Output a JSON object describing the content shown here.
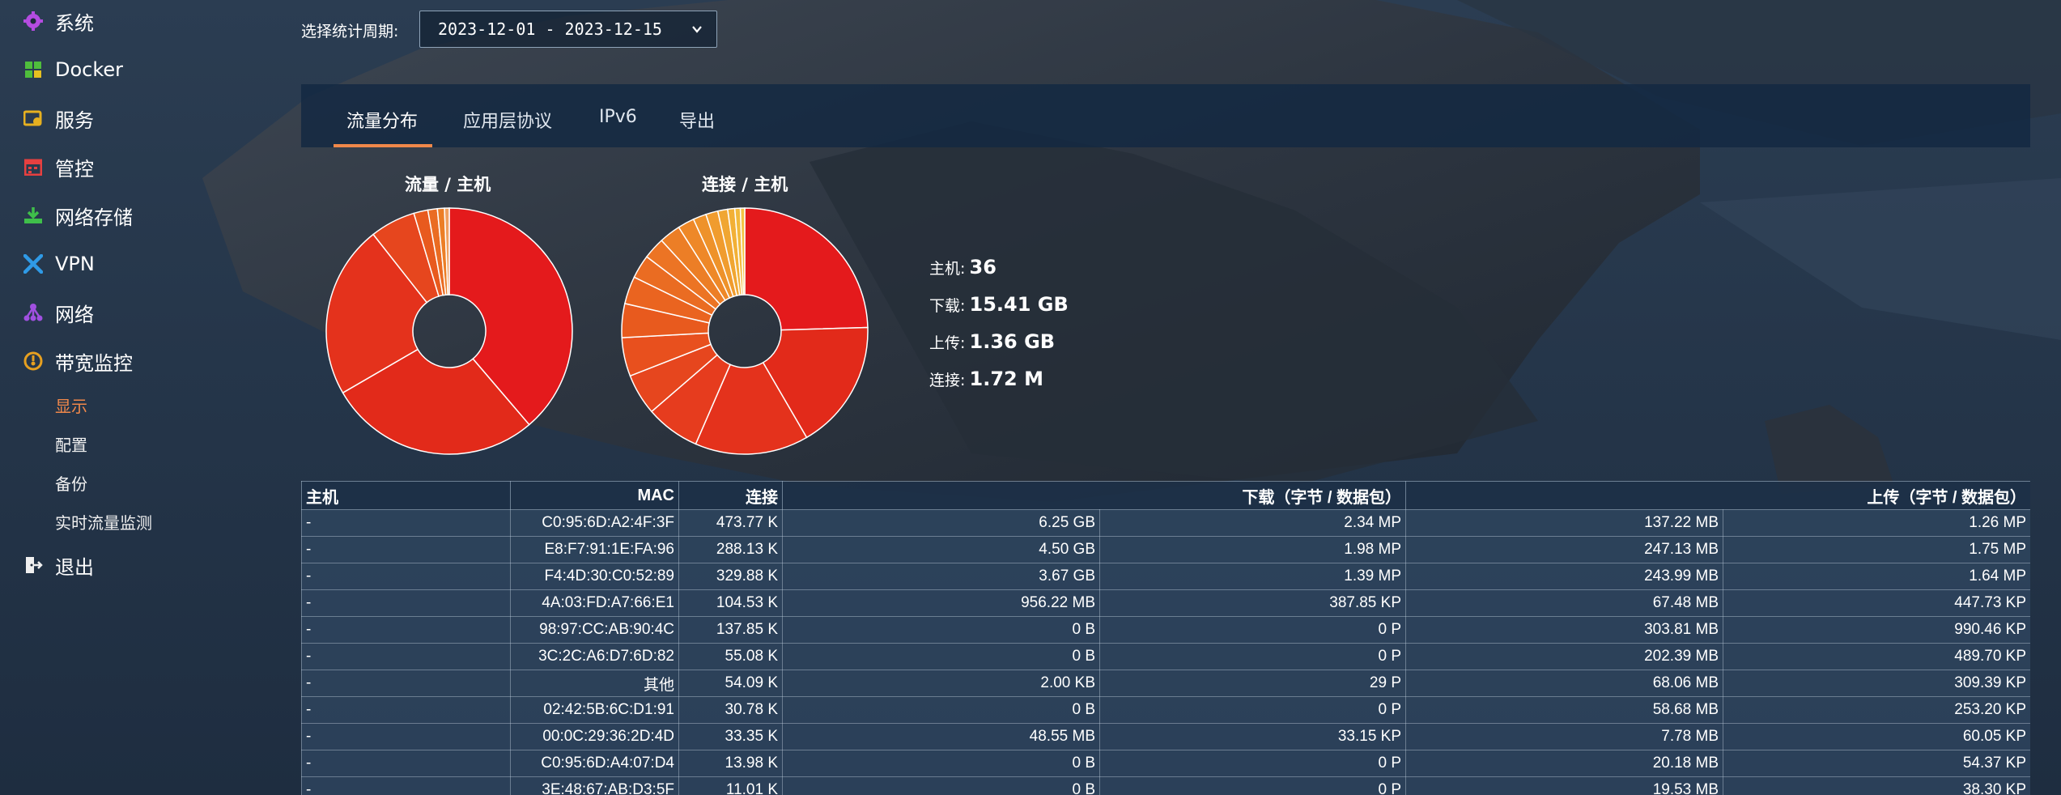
{
  "sidebar": {
    "items": [
      {
        "label": "系统",
        "icon": "gear-icon",
        "color": "#b44ce0"
      },
      {
        "label": "Docker",
        "icon": "grid-icon",
        "color": "#4fbe3c"
      },
      {
        "label": "服务",
        "icon": "service-icon",
        "color": "#e6b020"
      },
      {
        "label": "管控",
        "icon": "calendar-icon",
        "color": "#e64040"
      },
      {
        "label": "网络存储",
        "icon": "download-icon",
        "color": "#3fbf4a"
      },
      {
        "label": "VPN",
        "icon": "vpn-icon",
        "color": "#2f9ae6"
      },
      {
        "label": "网络",
        "icon": "network-icon",
        "color": "#a050e0"
      },
      {
        "label": "带宽监控",
        "icon": "gauge-icon",
        "color": "#e6a020"
      }
    ],
    "sub_items": [
      {
        "label": "显示",
        "active": true
      },
      {
        "label": "配置",
        "active": false
      },
      {
        "label": "备份",
        "active": false
      },
      {
        "label": "实时流量监测",
        "active": false
      }
    ],
    "logout": {
      "label": "退出",
      "icon": "logout-icon"
    }
  },
  "period": {
    "label": "选择统计周期:",
    "value": "2023-12-01 - 2023-12-15"
  },
  "tabs": [
    {
      "label": "流量分布",
      "active": true
    },
    {
      "label": "应用层协议",
      "active": false
    },
    {
      "label": "IPv6",
      "active": false
    },
    {
      "label": "导出",
      "active": false
    }
  ],
  "accent_color": "#f0884a",
  "charts": {
    "traffic": {
      "title": "流量 / 主机"
    },
    "connections": {
      "title": "连接 / 主机"
    }
  },
  "chart_data": [
    {
      "type": "pie",
      "title": "流量 / 主机",
      "values": [
        6.25,
        4.5,
        3.67,
        0.96,
        0.3,
        0.2,
        0.15,
        0.1
      ],
      "colors": [
        "#e41a1c",
        "#e22a1a",
        "#e4321c",
        "#e6461e",
        "#e85a1e",
        "#ea6c22",
        "#ec7e26",
        "#f0a060"
      ]
    },
    {
      "type": "pie",
      "title": "连接 / 主机",
      "values": [
        473.77,
        329.88,
        288.13,
        137.85,
        104.53,
        98,
        86,
        70,
        60,
        55.08,
        54.09,
        42,
        33.35,
        30.78,
        25,
        18,
        13.98,
        11.01
      ],
      "colors": [
        "#e41a1c",
        "#e22a1a",
        "#e4321c",
        "#e63c1e",
        "#e6461e",
        "#e8501e",
        "#e85a1e",
        "#ea6420",
        "#ea6c22",
        "#ec7424",
        "#ec7e26",
        "#ee8828",
        "#ee922a",
        "#f09c2e",
        "#f0a632",
        "#f2b036",
        "#f2ba3c",
        "#f4c444"
      ]
    }
  ],
  "stats": {
    "hosts": {
      "label": "主机:",
      "value": "36"
    },
    "download": {
      "label": "下载:",
      "value": "15.41 GB"
    },
    "upload": {
      "label": "上传:",
      "value": "1.36 GB"
    },
    "connections": {
      "label": "连接:",
      "value": "1.72 M"
    }
  },
  "table": {
    "headers": [
      "主机",
      "MAC",
      "连接",
      "下载（字节 / 数据包）",
      "上传（字节 / 数据包）"
    ],
    "rows": [
      [
        "-",
        "C0:95:6D:A2:4F:3F",
        "473.77 K",
        "6.25 GB",
        "2.34 MP",
        "137.22 MB",
        "1.26 MP"
      ],
      [
        "-",
        "E8:F7:91:1E:FA:96",
        "288.13 K",
        "4.50 GB",
        "1.98 MP",
        "247.13 MB",
        "1.75 MP"
      ],
      [
        "-",
        "F4:4D:30:C0:52:89",
        "329.88 K",
        "3.67 GB",
        "1.39 MP",
        "243.99 MB",
        "1.64 MP"
      ],
      [
        "-",
        "4A:03:FD:A7:66:E1",
        "104.53 K",
        "956.22 MB",
        "387.85 KP",
        "67.48 MB",
        "447.73 KP"
      ],
      [
        "-",
        "98:97:CC:AB:90:4C",
        "137.85 K",
        "0 B",
        "0 P",
        "303.81 MB",
        "990.46 KP"
      ],
      [
        "-",
        "3C:2C:A6:D7:6D:82",
        "55.08 K",
        "0 B",
        "0 P",
        "202.39 MB",
        "489.70 KP"
      ],
      [
        "-",
        "其他",
        "54.09 K",
        "2.00 KB",
        "29 P",
        "68.06 MB",
        "309.39 KP"
      ],
      [
        "-",
        "02:42:5B:6C:D1:91",
        "30.78 K",
        "0 B",
        "0 P",
        "58.68 MB",
        "253.20 KP"
      ],
      [
        "-",
        "00:0C:29:36:2D:4D",
        "33.35 K",
        "48.55 MB",
        "33.15 KP",
        "7.78 MB",
        "60.05 KP"
      ],
      [
        "-",
        "C0:95:6D:A4:07:D4",
        "13.98 K",
        "0 B",
        "0 P",
        "20.18 MB",
        "54.37 KP"
      ],
      [
        "-",
        "3E:48:67:AB:D3:5F",
        "11.01 K",
        "0 B",
        "0 P",
        "19.53 MB",
        "38.30 KP"
      ]
    ]
  }
}
